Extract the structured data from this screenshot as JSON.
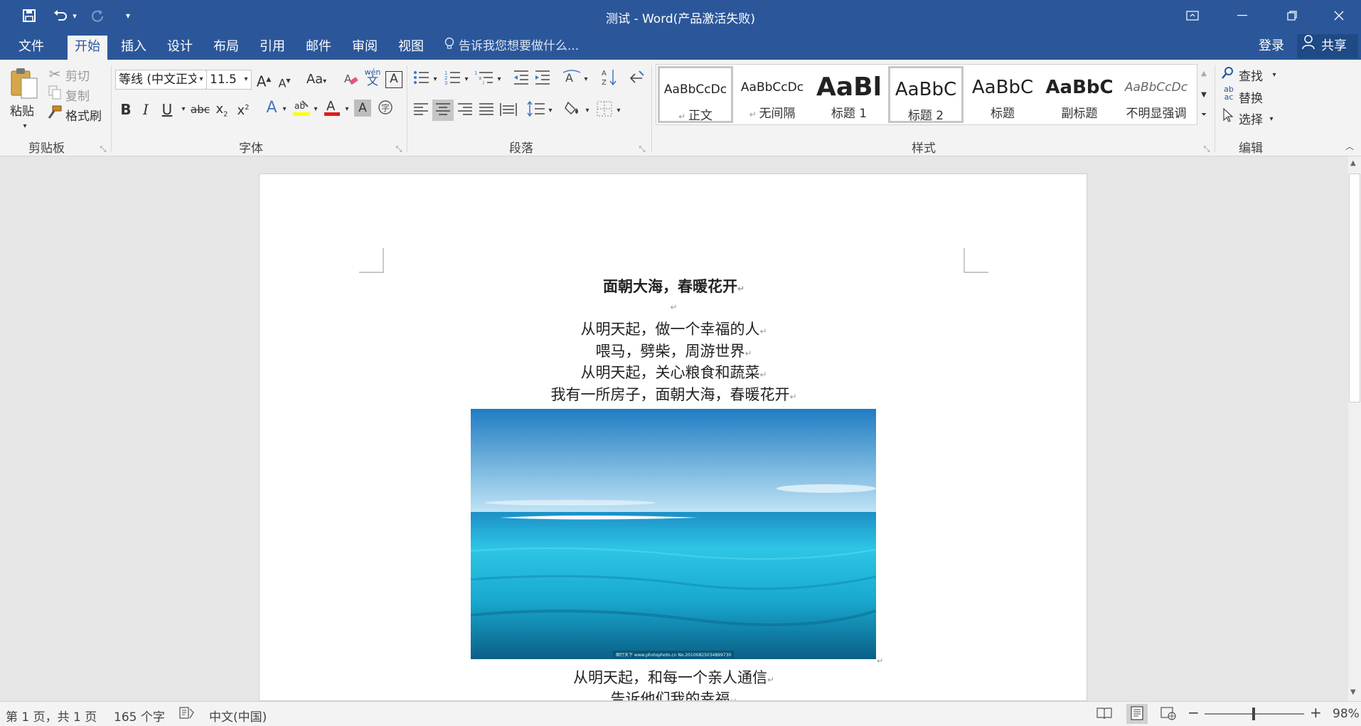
{
  "window": {
    "title": "测试 - Word(产品激活失败)"
  },
  "tabs": [
    "文件",
    "开始",
    "插入",
    "设计",
    "布局",
    "引用",
    "邮件",
    "审阅",
    "视图"
  ],
  "tell_me": "告诉我您想要做什么...",
  "account": {
    "login": "登录",
    "share": "共享"
  },
  "clipboard": {
    "paste": "粘贴",
    "cut": "剪切",
    "copy": "复制",
    "format_painter": "格式刷",
    "group": "剪贴板"
  },
  "font": {
    "name": "等线 (中文正文",
    "size": "11.5",
    "group": "字体"
  },
  "paragraph": {
    "group": "段落"
  },
  "styles": {
    "group": "样式",
    "items": [
      {
        "sample": "AaBbCcDc",
        "name": "正文"
      },
      {
        "sample": "AaBbCcDc",
        "name": "无间隔"
      },
      {
        "sample": "AaBl",
        "name": "标题 1"
      },
      {
        "sample": "AaBbC",
        "name": "标题 2"
      },
      {
        "sample": "AaBbC",
        "name": "标题"
      },
      {
        "sample": "AaBbC",
        "name": "副标题"
      },
      {
        "sample": "AaBbCcDc",
        "name": "不明显强调"
      }
    ]
  },
  "editing": {
    "find": "查找",
    "replace": "替换",
    "select": "选择",
    "group": "编辑"
  },
  "document": {
    "title": "面朝大海，春暖花开",
    "lines": [
      "从明天起，做一个幸福的人",
      "喂马，劈柴，周游世界",
      "从明天起，关心粮食和蔬菜",
      "我有一所房子，面朝大海，春暖花开"
    ],
    "after_image": [
      "从明天起，和每一个亲人通信",
      "告诉他们我的幸福"
    ],
    "image_caption": "图行天下 www.photophoto.cn No.20100825034899730"
  },
  "status": {
    "page": "第 1 页，共 1 页",
    "words": "165 个字",
    "language": "中文(中国)",
    "zoom": "98%"
  },
  "colors": {
    "brand": "#2b579a",
    "ribbon": "#f3f3f3",
    "canvas": "#e6e6e6"
  }
}
